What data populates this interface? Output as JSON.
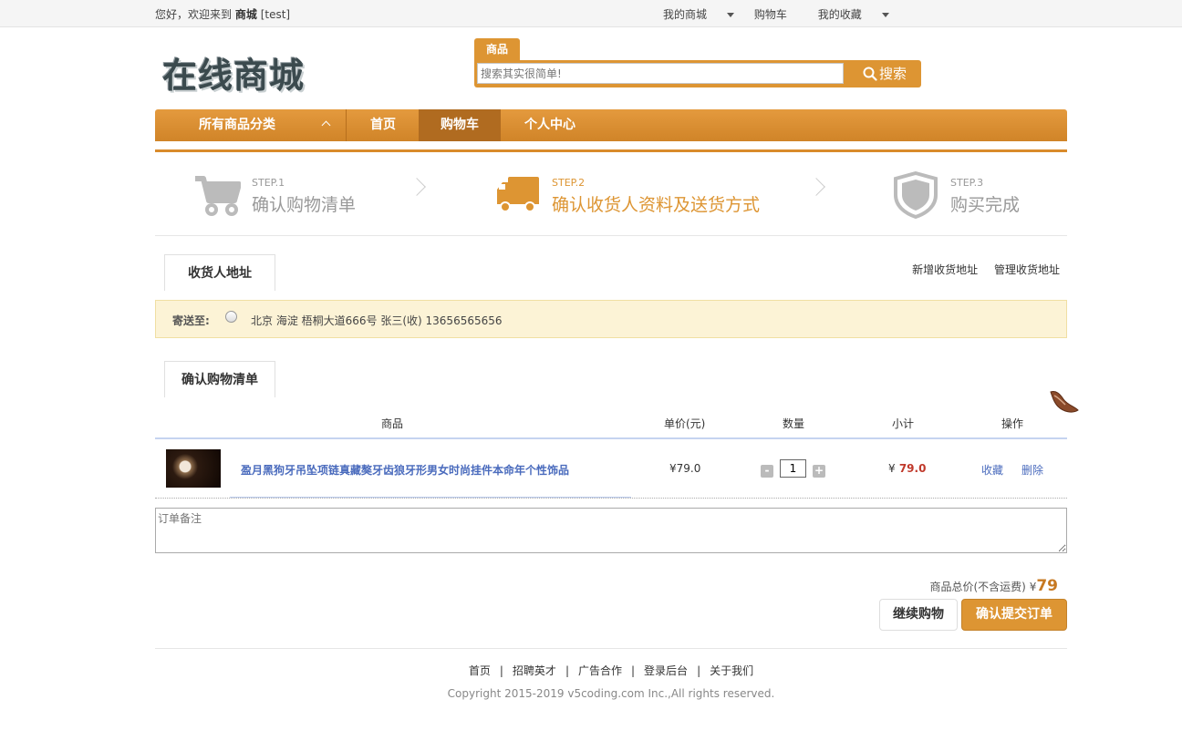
{
  "topbar": {
    "greeting": "您好，欢迎来到",
    "site": "商城",
    "user": "[test]",
    "links": {
      "my_mall": "我的商城",
      "cart": "购物车",
      "favorites": "我的收藏"
    }
  },
  "logo": {
    "text": "在线商城"
  },
  "search": {
    "tab": "商品",
    "placeholder": "搜索其实很简单!",
    "button": "搜索"
  },
  "nav": {
    "category": "所有商品分类",
    "items": [
      "首页",
      "购物车",
      "个人中心"
    ],
    "active": "购物车"
  },
  "steps": [
    {
      "step": "STEP.1",
      "label": "确认购物清单",
      "icon": "cart-icon"
    },
    {
      "step": "STEP.2",
      "label": "确认收货人资料及送货方式",
      "icon": "truck-icon",
      "active": true
    },
    {
      "step": "STEP.3",
      "label": "购买完成",
      "icon": "shield-icon"
    }
  ],
  "address": {
    "tab": "收货人地址",
    "add": "新增收货地址",
    "manage": "管理收货地址",
    "ship_to": "寄送至:",
    "line": "北京 海淀 梧桐大道666号  张三(收)  13656565656"
  },
  "cart_list": {
    "tab": "确认购物清单",
    "headers": {
      "product": "商品",
      "price": "单价(元)",
      "qty": "数量",
      "subtotal": "小计",
      "ops": "操作"
    },
    "items": [
      {
        "name": "盈月黑狗牙吊坠项链真藏獒牙齿狼牙形男女时尚挂件本命年个性饰品",
        "price": "¥79.0",
        "qty": "1",
        "subtotal_symbol": "¥",
        "subtotal": "79.0",
        "fav": "收藏",
        "del": "删除"
      }
    ]
  },
  "remark": {
    "placeholder": "订单备注"
  },
  "summary": {
    "label": "商品总价(不含运费)",
    "symbol": "¥",
    "total": "79"
  },
  "buttons": {
    "continue": "继续购物",
    "submit": "确认提交订单"
  },
  "footer": {
    "links": [
      "首页",
      "招聘英才",
      "广告合作",
      "登录后台",
      "关于我们"
    ],
    "copyright": "Copyright 2015-2019 v5coding.com Inc.,All rights reserved."
  },
  "colors": {
    "accent": "#dd9533",
    "nav_active": "#b06b20",
    "link": "#4a6bbd",
    "price": "#c0392b"
  }
}
